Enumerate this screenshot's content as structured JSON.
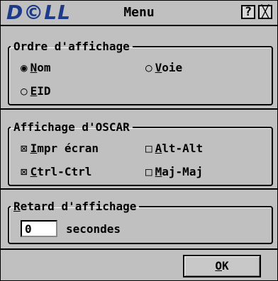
{
  "titlebar": {
    "logo": "D©LL",
    "title": "Menu",
    "help_label": "?",
    "close_label": "╳"
  },
  "ordre": {
    "legend": "Ordre d'affichage",
    "options": [
      {
        "glyph": "◉",
        "first": "N",
        "rest": "om",
        "selected": true
      },
      {
        "glyph": "○",
        "first": "V",
        "rest": "oie",
        "selected": false
      },
      {
        "glyph": "○",
        "first": "E",
        "rest": "ID",
        "selected": false
      }
    ]
  },
  "oscar": {
    "legend": "Affichage d'OSCAR",
    "options": [
      {
        "glyph": "⊠",
        "first": "I",
        "rest": "mpr écran",
        "checked": true
      },
      {
        "glyph": "□",
        "first": "A",
        "rest": "lt-Alt",
        "checked": false
      },
      {
        "glyph": "⊠",
        "first": "C",
        "rest": "trl-Ctrl",
        "checked": true
      },
      {
        "glyph": "□",
        "first": "M",
        "rest": "aj-Maj",
        "checked": false
      }
    ]
  },
  "retard": {
    "legend_first": "R",
    "legend_rest": "etard d'affichage",
    "value": "0",
    "unit": "secondes"
  },
  "ok_first": "O",
  "ok_rest": "K"
}
